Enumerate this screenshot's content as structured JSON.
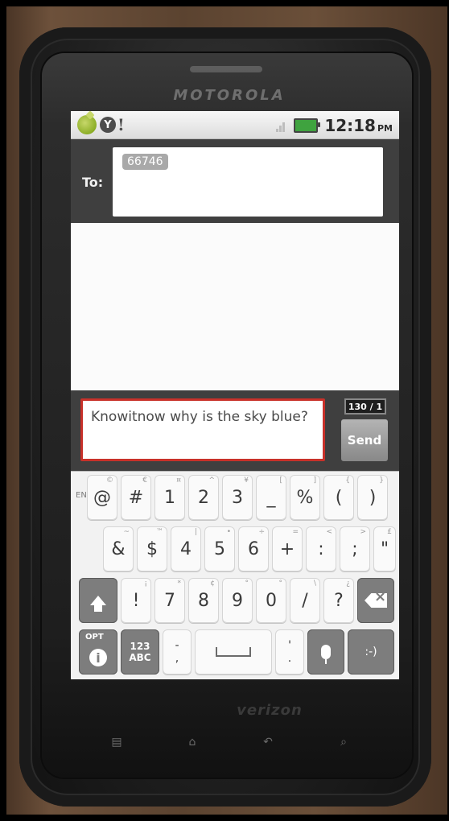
{
  "device": {
    "brand": "MOTOROLA",
    "carrier": "verizon"
  },
  "status_bar": {
    "time": "12:18",
    "ampm": "PM",
    "notification_icons": [
      "android-cat-icon",
      "yahoo-icon"
    ],
    "battery_color": "#3fa33f"
  },
  "compose": {
    "to_label": "To:",
    "recipient": "66746",
    "message": "Knowitnow why is the sky blue?",
    "char_counter": "130 / 1",
    "send_label": "Send",
    "accent_border": "#c8312a"
  },
  "keyboard": {
    "lang_label": "EN",
    "rows": [
      [
        {
          "label": "@",
          "sub": "©"
        },
        {
          "label": "#",
          "sub": "€"
        },
        {
          "label": "1",
          "sub": "¤"
        },
        {
          "label": "2",
          "sub": "^"
        },
        {
          "label": "3",
          "sub": "¥"
        },
        {
          "label": "_",
          "sub": "["
        },
        {
          "label": "%",
          "sub": "]"
        },
        {
          "label": "(",
          "sub": "{"
        },
        {
          "label": ")",
          "sub": "}"
        }
      ],
      [
        {
          "label": "&",
          "sub": "~"
        },
        {
          "label": "$",
          "sub": "™"
        },
        {
          "label": "4",
          "sub": "|"
        },
        {
          "label": "5",
          "sub": "•"
        },
        {
          "label": "6",
          "sub": "÷"
        },
        {
          "label": "+",
          "sub": "="
        },
        {
          "label": ":",
          "sub": "<"
        },
        {
          "label": ";",
          "sub": ">"
        },
        {
          "label": "\"",
          "sub": "£"
        }
      ],
      [
        {
          "label": "!",
          "sub": "¡"
        },
        {
          "label": "7",
          "sub": "*"
        },
        {
          "label": "8",
          "sub": "¢"
        },
        {
          "label": "9",
          "sub": "°"
        },
        {
          "label": "0",
          "sub": "°"
        },
        {
          "label": "/",
          "sub": "\\"
        },
        {
          "label": "?",
          "sub": "¿"
        }
      ]
    ],
    "bottom": {
      "opt_label": "OPT",
      "info_label": "i",
      "num_label": "123",
      "abc_label": "ABC",
      "comma_label": ",",
      "dash_label": "-",
      "period_label": ".",
      "apostrophe_label": "'",
      "emoji_label": ":-)"
    }
  }
}
